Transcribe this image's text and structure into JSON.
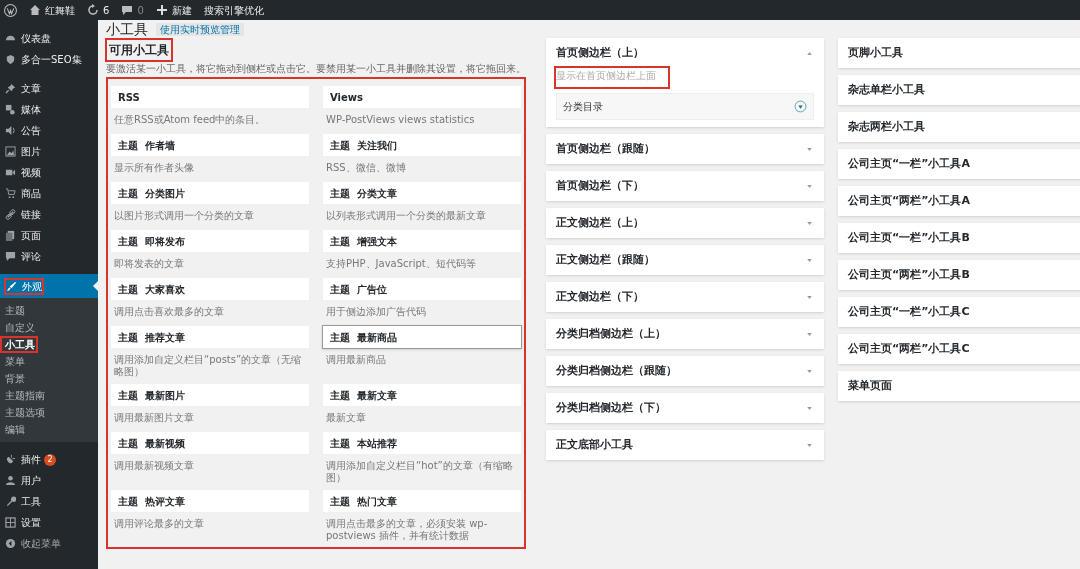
{
  "top_bar": {
    "site": "红舞鞋",
    "updates": "6",
    "comments": "0",
    "new": "新建",
    "seo": "搜索引擎优化"
  },
  "menu": [
    {
      "label": "仪表盘",
      "kind": "item"
    },
    {
      "label": "多合一SEO集",
      "kind": "item"
    },
    {
      "kind": "separator"
    },
    {
      "label": "文章",
      "kind": "item"
    },
    {
      "label": "媒体",
      "kind": "item"
    },
    {
      "label": "公告",
      "kind": "item"
    },
    {
      "label": "图片",
      "kind": "item"
    },
    {
      "label": "视频",
      "kind": "item"
    },
    {
      "label": "商品",
      "kind": "item"
    },
    {
      "label": "链接",
      "kind": "item"
    },
    {
      "label": "页面",
      "kind": "item"
    },
    {
      "label": "评论",
      "kind": "item"
    },
    {
      "label": "外观",
      "kind": "current",
      "highlighted": true,
      "submenu": [
        {
          "label": "主题",
          "selected": false,
          "highlighted": false
        },
        {
          "label": "自定义",
          "selected": false,
          "highlighted": false
        },
        {
          "label": "小工具",
          "selected": true,
          "highlighted": true
        },
        {
          "label": "菜单",
          "selected": false,
          "highlighted": false
        },
        {
          "label": "背景",
          "selected": false,
          "highlighted": false
        },
        {
          "label": "主题指南",
          "selected": false,
          "highlighted": false
        },
        {
          "label": "主题选项",
          "selected": false,
          "highlighted": false
        },
        {
          "label": "编辑",
          "selected": false,
          "highlighted": false
        }
      ]
    },
    {
      "label": "插件",
      "kind": "item",
      "badge": "2"
    },
    {
      "label": "用户",
      "kind": "item"
    },
    {
      "label": "工具",
      "kind": "item"
    },
    {
      "label": "设置",
      "kind": "item"
    },
    {
      "label": "收起菜单",
      "kind": "collapse"
    }
  ],
  "page": {
    "title": "小工具",
    "live_preview_button": "使用实时预览管理"
  },
  "available": {
    "title": "可用小工具",
    "title_highlighted": true,
    "description": "要激活某一小工具，将它拖动到侧栏或点击它。要禁用某一小工具并删除其设置，将它拖回来。",
    "list_highlighted": true,
    "widgets": [
      {
        "title": "RSS",
        "description": "任意RSS或Atom feed中的条目。",
        "focused": false
      },
      {
        "title": "Views",
        "description": "WP-PostViews views statistics",
        "focused": false
      },
      {
        "title": "主题  作者墙",
        "description": "显示所有作者头像",
        "focused": false
      },
      {
        "title": "主题  关注我们",
        "description": "RSS、微信、微博",
        "focused": false
      },
      {
        "title": "主题  分类图片",
        "description": "以图片形式调用一个分类的文章",
        "focused": false
      },
      {
        "title": "主题  分类文章",
        "description": "以列表形式调用一个分类的最新文章",
        "focused": false
      },
      {
        "title": "主题  即将发布",
        "description": "即将发表的文章",
        "focused": false
      },
      {
        "title": "主题  增强文本",
        "description": "支持PHP、JavaScript、短代码等",
        "focused": false
      },
      {
        "title": "主题  大家喜欢",
        "description": "调用点击喜欢最多的文章",
        "focused": false
      },
      {
        "title": "主题  广告位",
        "description": "用于侧边添加广告代码",
        "focused": false
      },
      {
        "title": "主题  推荐文章",
        "description": "调用添加自定义栏目“posts”的文章（无缩略图）",
        "focused": false
      },
      {
        "title": "主题  最新商品",
        "description": "调用最新商品",
        "focused": true
      },
      {
        "title": "主题  最新图片",
        "description": "调用最新图片文章",
        "focused": false
      },
      {
        "title": "主题  最新文章",
        "description": "最新文章",
        "focused": false
      },
      {
        "title": "主题  最新视频",
        "description": "调用最新视频文章",
        "focused": false
      },
      {
        "title": "主题  本站推荐",
        "description": "调用添加自定义栏目“hot”的文章（有缩略图）",
        "focused": false
      },
      {
        "title": "主题  热评文章",
        "description": "调用评论最多的文章",
        "focused": false
      },
      {
        "title": "主题  热门文章",
        "description": "调用点击最多的文章，必须安装 wp-postviews 插件，并有统计数据",
        "focused": false
      }
    ]
  },
  "sidebars": [
    {
      "name": "首页侧边栏（上）",
      "expanded": true,
      "description": "显示在首页侧边栏上面",
      "description_highlighted": true,
      "widgets": [
        "分类目录"
      ]
    },
    {
      "name": "首页侧边栏（跟随）",
      "expanded": false
    },
    {
      "name": "首页侧边栏（下）",
      "expanded": false
    },
    {
      "name": "正文侧边栏（上）",
      "expanded": false
    },
    {
      "name": "正文侧边栏（跟随）",
      "expanded": false
    },
    {
      "name": "正文侧边栏（下）",
      "expanded": false
    },
    {
      "name": "分类归档侧边栏（上）",
      "expanded": false
    },
    {
      "name": "分类归档侧边栏（跟随）",
      "expanded": false
    },
    {
      "name": "分类归档侧边栏（下）",
      "expanded": false
    },
    {
      "name": "正文底部小工具",
      "expanded": false
    }
  ],
  "sidebars_right": [
    {
      "name": "页脚小工具"
    },
    {
      "name": "杂志单栏小工具"
    },
    {
      "name": "杂志两栏小工具"
    },
    {
      "name": "公司主页“一栏”小工具A"
    },
    {
      "name": "公司主页“两栏”小工具A"
    },
    {
      "name": "公司主页“一栏”小工具B"
    },
    {
      "name": "公司主页“两栏”小工具B"
    },
    {
      "name": "公司主页“一栏”小工具C"
    },
    {
      "name": "公司主页“两栏”小工具C"
    },
    {
      "name": "菜单页面"
    }
  ]
}
